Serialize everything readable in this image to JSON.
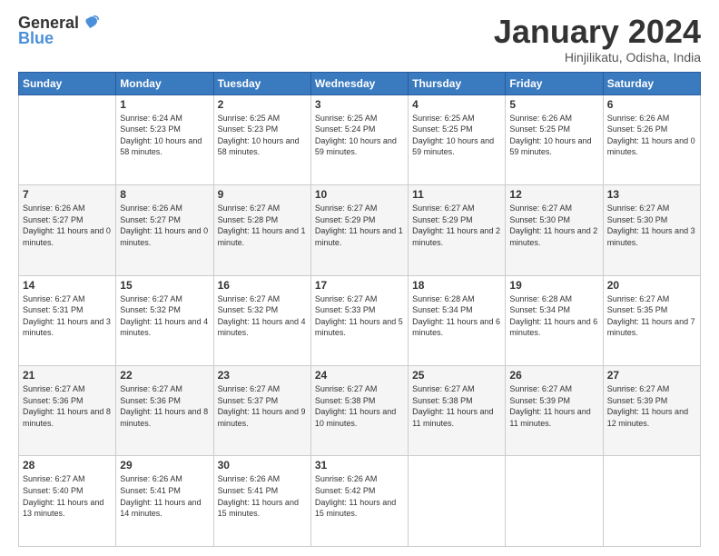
{
  "logo": {
    "general": "General",
    "blue": "Blue"
  },
  "title": "January 2024",
  "subtitle": "Hinjilikatu, Odisha, India",
  "weekdays": [
    "Sunday",
    "Monday",
    "Tuesday",
    "Wednesday",
    "Thursday",
    "Friday",
    "Saturday"
  ],
  "weeks": [
    [
      null,
      {
        "day": 1,
        "sunrise": "6:24 AM",
        "sunset": "5:23 PM",
        "daylight": "10 hours and 58 minutes."
      },
      {
        "day": 2,
        "sunrise": "6:25 AM",
        "sunset": "5:23 PM",
        "daylight": "10 hours and 58 minutes."
      },
      {
        "day": 3,
        "sunrise": "6:25 AM",
        "sunset": "5:24 PM",
        "daylight": "10 hours and 59 minutes."
      },
      {
        "day": 4,
        "sunrise": "6:25 AM",
        "sunset": "5:25 PM",
        "daylight": "10 hours and 59 minutes."
      },
      {
        "day": 5,
        "sunrise": "6:26 AM",
        "sunset": "5:25 PM",
        "daylight": "10 hours and 59 minutes."
      },
      {
        "day": 6,
        "sunrise": "6:26 AM",
        "sunset": "5:26 PM",
        "daylight": "11 hours and 0 minutes."
      }
    ],
    [
      {
        "day": 7,
        "sunrise": "6:26 AM",
        "sunset": "5:27 PM",
        "daylight": "11 hours and 0 minutes."
      },
      {
        "day": 8,
        "sunrise": "6:26 AM",
        "sunset": "5:27 PM",
        "daylight": "11 hours and 0 minutes."
      },
      {
        "day": 9,
        "sunrise": "6:27 AM",
        "sunset": "5:28 PM",
        "daylight": "11 hours and 1 minute."
      },
      {
        "day": 10,
        "sunrise": "6:27 AM",
        "sunset": "5:29 PM",
        "daylight": "11 hours and 1 minute."
      },
      {
        "day": 11,
        "sunrise": "6:27 AM",
        "sunset": "5:29 PM",
        "daylight": "11 hours and 2 minutes."
      },
      {
        "day": 12,
        "sunrise": "6:27 AM",
        "sunset": "5:30 PM",
        "daylight": "11 hours and 2 minutes."
      },
      {
        "day": 13,
        "sunrise": "6:27 AM",
        "sunset": "5:30 PM",
        "daylight": "11 hours and 3 minutes."
      }
    ],
    [
      {
        "day": 14,
        "sunrise": "6:27 AM",
        "sunset": "5:31 PM",
        "daylight": "11 hours and 3 minutes."
      },
      {
        "day": 15,
        "sunrise": "6:27 AM",
        "sunset": "5:32 PM",
        "daylight": "11 hours and 4 minutes."
      },
      {
        "day": 16,
        "sunrise": "6:27 AM",
        "sunset": "5:32 PM",
        "daylight": "11 hours and 4 minutes."
      },
      {
        "day": 17,
        "sunrise": "6:27 AM",
        "sunset": "5:33 PM",
        "daylight": "11 hours and 5 minutes."
      },
      {
        "day": 18,
        "sunrise": "6:28 AM",
        "sunset": "5:34 PM",
        "daylight": "11 hours and 6 minutes."
      },
      {
        "day": 19,
        "sunrise": "6:28 AM",
        "sunset": "5:34 PM",
        "daylight": "11 hours and 6 minutes."
      },
      {
        "day": 20,
        "sunrise": "6:27 AM",
        "sunset": "5:35 PM",
        "daylight": "11 hours and 7 minutes."
      }
    ],
    [
      {
        "day": 21,
        "sunrise": "6:27 AM",
        "sunset": "5:36 PM",
        "daylight": "11 hours and 8 minutes."
      },
      {
        "day": 22,
        "sunrise": "6:27 AM",
        "sunset": "5:36 PM",
        "daylight": "11 hours and 8 minutes."
      },
      {
        "day": 23,
        "sunrise": "6:27 AM",
        "sunset": "5:37 PM",
        "daylight": "11 hours and 9 minutes."
      },
      {
        "day": 24,
        "sunrise": "6:27 AM",
        "sunset": "5:38 PM",
        "daylight": "11 hours and 10 minutes."
      },
      {
        "day": 25,
        "sunrise": "6:27 AM",
        "sunset": "5:38 PM",
        "daylight": "11 hours and 11 minutes."
      },
      {
        "day": 26,
        "sunrise": "6:27 AM",
        "sunset": "5:39 PM",
        "daylight": "11 hours and 11 minutes."
      },
      {
        "day": 27,
        "sunrise": "6:27 AM",
        "sunset": "5:39 PM",
        "daylight": "11 hours and 12 minutes."
      }
    ],
    [
      {
        "day": 28,
        "sunrise": "6:27 AM",
        "sunset": "5:40 PM",
        "daylight": "11 hours and 13 minutes."
      },
      {
        "day": 29,
        "sunrise": "6:26 AM",
        "sunset": "5:41 PM",
        "daylight": "11 hours and 14 minutes."
      },
      {
        "day": 30,
        "sunrise": "6:26 AM",
        "sunset": "5:41 PM",
        "daylight": "11 hours and 15 minutes."
      },
      {
        "day": 31,
        "sunrise": "6:26 AM",
        "sunset": "5:42 PM",
        "daylight": "11 hours and 15 minutes."
      },
      null,
      null,
      null
    ]
  ]
}
